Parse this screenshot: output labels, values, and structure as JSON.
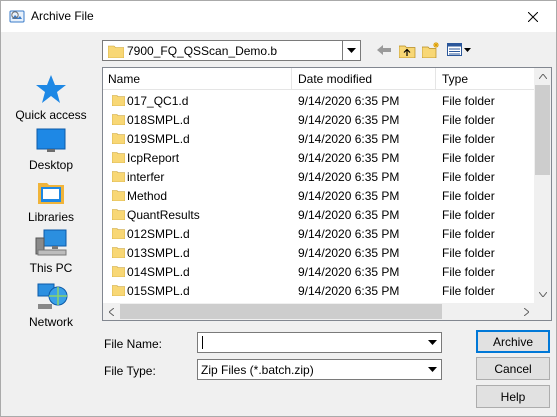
{
  "window": {
    "title": "Archive File"
  },
  "toolbar": {
    "lookin_value": "7900_FQ_QSScan_Demo.b",
    "icons": [
      "back-arrow-icon",
      "up-folder-icon",
      "new-folder-icon",
      "view-menu-icon"
    ]
  },
  "places": [
    {
      "label": "Quick access",
      "icon": "star-icon"
    },
    {
      "label": "Desktop",
      "icon": "desktop-icon"
    },
    {
      "label": "Libraries",
      "icon": "libraries-icon"
    },
    {
      "label": "This PC",
      "icon": "computer-icon"
    },
    {
      "label": "Network",
      "icon": "network-icon"
    }
  ],
  "filelist": {
    "columns": [
      "Name",
      "Date modified",
      "Type"
    ],
    "rows": [
      {
        "name": "017_QC1.d",
        "date": "9/14/2020 6:35 PM",
        "type": "File folder"
      },
      {
        "name": "018SMPL.d",
        "date": "9/14/2020 6:35 PM",
        "type": "File folder"
      },
      {
        "name": "019SMPL.d",
        "date": "9/14/2020 6:35 PM",
        "type": "File folder"
      },
      {
        "name": "IcpReport",
        "date": "9/14/2020 6:35 PM",
        "type": "File folder"
      },
      {
        "name": "interfer",
        "date": "9/14/2020 6:35 PM",
        "type": "File folder"
      },
      {
        "name": "Method",
        "date": "9/14/2020 6:35 PM",
        "type": "File folder"
      },
      {
        "name": "QuantResults",
        "date": "9/14/2020 6:35 PM",
        "type": "File folder"
      },
      {
        "name": "012SMPL.d",
        "date": "9/14/2020 6:35 PM",
        "type": "File folder"
      },
      {
        "name": "013SMPL.d",
        "date": "9/14/2020 6:35 PM",
        "type": "File folder"
      },
      {
        "name": "014SMPL.d",
        "date": "9/14/2020 6:35 PM",
        "type": "File folder"
      },
      {
        "name": "015SMPL.d",
        "date": "9/14/2020 6:35 PM",
        "type": "File folder"
      }
    ]
  },
  "form": {
    "file_name_label": "File Name:",
    "file_name_value": "",
    "file_type_label": "File Type:",
    "file_type_value": "Zip Files (*.batch.zip)"
  },
  "buttons": {
    "archive": "Archive",
    "cancel": "Cancel",
    "help": "Help"
  },
  "colors": {
    "accent": "#0078d7",
    "folder": "#f8d775"
  }
}
